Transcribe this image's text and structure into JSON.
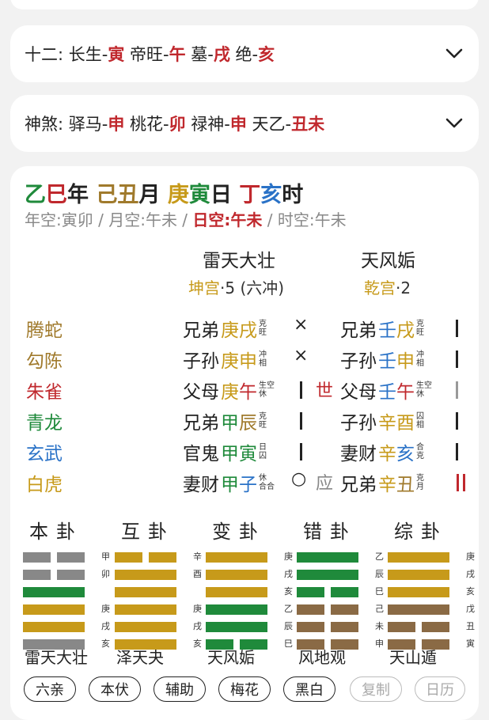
{
  "row_shier": {
    "prefix": "十二: ",
    "parts": [
      {
        "t": "长生-",
        "c": ""
      },
      {
        "t": "寅",
        "c": "red"
      },
      {
        "t": " 帝旺-",
        "c": ""
      },
      {
        "t": "午",
        "c": "red"
      },
      {
        "t": " 墓-",
        "c": ""
      },
      {
        "t": "戌",
        "c": "red"
      },
      {
        "t": " 绝-",
        "c": ""
      },
      {
        "t": "亥",
        "c": "red"
      }
    ]
  },
  "row_shensha": {
    "prefix": "神煞: ",
    "parts": [
      {
        "t": "驿马-",
        "c": ""
      },
      {
        "t": "申",
        "c": "red"
      },
      {
        "t": " 桃花-",
        "c": ""
      },
      {
        "t": "卯",
        "c": "red"
      },
      {
        "t": " 禄神-",
        "c": ""
      },
      {
        "t": "申",
        "c": "red"
      },
      {
        "t": " 天乙-",
        "c": ""
      },
      {
        "t": "丑未",
        "c": "red"
      }
    ]
  },
  "date": [
    {
      "t": "乙",
      "c": "#1f8a3b"
    },
    {
      "t": "巳",
      "c": "#c0282d"
    },
    {
      "t": "年 ",
      "c": "#222"
    },
    {
      "t": "己",
      "c": "#a07a2c"
    },
    {
      "t": "丑",
      "c": "#a07a2c"
    },
    {
      "t": "月 ",
      "c": "#222"
    },
    {
      "t": "庚",
      "c": "#c79a1a"
    },
    {
      "t": "寅",
      "c": "#1f8a3b"
    },
    {
      "t": "日 ",
      "c": "#222"
    },
    {
      "t": "丁",
      "c": "#c0282d"
    },
    {
      "t": "亥",
      "c": "#2a72c7"
    },
    {
      "t": "时",
      "c": "#222"
    }
  ],
  "kong": {
    "year": "年空:寅卯",
    "sep1": " / ",
    "month": "月空:午未",
    "sep2": " / ",
    "day": "日空:午未",
    "sep3": " / ",
    "hour": "时空:午未"
  },
  "gua_main": {
    "name": "雷天大壮",
    "palace": "坤宫",
    "rest": "·5 (六冲)"
  },
  "gua_change": {
    "name": "天风姤",
    "palace": "乾宫",
    "rest": "·2"
  },
  "gods": [
    {
      "t": "腾蛇",
      "c": "#a07a2c"
    },
    {
      "t": "勾陈",
      "c": "#a07a2c"
    },
    {
      "t": "朱雀",
      "c": "#c0282d"
    },
    {
      "t": "青龙",
      "c": "#1f8a3b"
    },
    {
      "t": "玄武",
      "c": "#2a72c7"
    },
    {
      "t": "白虎",
      "c": "#c79a1a"
    }
  ],
  "lines_main": [
    {
      "rel": "兄弟",
      "g1": "庚",
      "c1": "#c79a1a",
      "g2": "戌",
      "c2": "#c79a1a",
      "s1": "克",
      "s2": "旺"
    },
    {
      "rel": "子孙",
      "g1": "庚",
      "c1": "#c79a1a",
      "g2": "申",
      "c2": "#c79a1a",
      "s1": "冲",
      "s2": "相"
    },
    {
      "rel": "父母",
      "g1": "庚",
      "c1": "#c79a1a",
      "g2": "午",
      "c2": "#c0282d",
      "s1": "生空",
      "s2": "休"
    },
    {
      "rel": "兄弟",
      "g1": "甲",
      "c1": "#1f8a3b",
      "g2": "辰",
      "c2": "#a07a2c",
      "s1": "克",
      "s2": "旺"
    },
    {
      "rel": "官鬼",
      "g1": "甲",
      "c1": "#1f8a3b",
      "g2": "寅",
      "c2": "#1f8a3b",
      "s1": "日",
      "s2": "囚"
    },
    {
      "rel": "妻财",
      "g1": "甲",
      "c1": "#1f8a3b",
      "g2": "子",
      "c2": "#2a72c7",
      "s1": "休",
      "s2": "合合"
    }
  ],
  "moving_marks": [
    "×",
    "×",
    "",
    "",
    "",
    "○"
  ],
  "shi_ying": [
    "",
    "",
    "世",
    "",
    "",
    "应"
  ],
  "lines_change": [
    {
      "rel": "兄弟",
      "g1": "壬",
      "c1": "#2a72c7",
      "g2": "戌",
      "c2": "#c79a1a",
      "s1": "克",
      "s2": "旺"
    },
    {
      "rel": "子孙",
      "g1": "壬",
      "c1": "#2a72c7",
      "g2": "申",
      "c2": "#c79a1a",
      "s1": "冲",
      "s2": "相"
    },
    {
      "rel": "父母",
      "g1": "壬",
      "c1": "#2a72c7",
      "g2": "午",
      "c2": "#c0282d",
      "s1": "生空",
      "s2": "休"
    },
    {
      "rel": "子孙",
      "g1": "辛",
      "c1": "#c79a1a",
      "g2": "酉",
      "c2": "#c79a1a",
      "s1": "囚",
      "s2": "相"
    },
    {
      "rel": "妻财",
      "g1": "辛",
      "c1": "#c79a1a",
      "g2": "亥",
      "c2": "#2a72c7",
      "s1": "合",
      "s2": "克"
    },
    {
      "rel": "兄弟",
      "g1": "辛",
      "c1": "#c79a1a",
      "g2": "丑",
      "c2": "#a07a2c",
      "s1": "克",
      "s2": "月"
    }
  ],
  "hex_heads": [
    "本卦",
    "互卦",
    "变卦",
    "错卦",
    "综卦"
  ],
  "hex_names": [
    "雷天大壮",
    "泽天夬",
    "天风姤",
    "风地观",
    "天山遁"
  ],
  "hexagrams": [
    {
      "lines": [
        [
          0,
          "#888"
        ],
        [
          0,
          "#888"
        ],
        [
          1,
          "#1f8a3b"
        ],
        [
          1,
          "#c79a1a"
        ],
        [
          1,
          "#c79a1a"
        ],
        [
          1,
          "#888"
        ]
      ],
      "labels": [
        "甲",
        "卯",
        "",
        "庚",
        "戌",
        "亥"
      ]
    },
    {
      "lines": [
        [
          0,
          "#c79a1a"
        ],
        [
          1,
          "#c79a1a"
        ],
        [
          1,
          "#c79a1a"
        ],
        [
          1,
          "#c79a1a"
        ],
        [
          1,
          "#c79a1a"
        ],
        [
          1,
          "#c79a1a"
        ]
      ],
      "labels": [
        "辛",
        "酉",
        "",
        "庚",
        "戌",
        "亥"
      ]
    },
    {
      "lines": [
        [
          1,
          "#c79a1a"
        ],
        [
          1,
          "#c79a1a"
        ],
        [
          1,
          "#c79a1a"
        ],
        [
          1,
          "#1f8a3b"
        ],
        [
          1,
          "#1f8a3b"
        ],
        [
          0,
          "#1f8a3b"
        ]
      ],
      "labels": [
        "庚",
        "戌",
        "亥",
        "乙",
        "辰",
        "巳"
      ]
    },
    {
      "lines": [
        [
          1,
          "#1f8a3b"
        ],
        [
          1,
          "#1f8a3b"
        ],
        [
          0,
          "#1f8a3b"
        ],
        [
          0,
          "#8a6a45"
        ],
        [
          0,
          "#8a6a45"
        ],
        [
          0,
          "#8a6a45"
        ]
      ],
      "labels": [
        "乙",
        "辰",
        "巳",
        "己",
        "未",
        "申"
      ]
    },
    {
      "lines": [
        [
          1,
          "#c79a1a"
        ],
        [
          1,
          "#c79a1a"
        ],
        [
          1,
          "#c79a1a"
        ],
        [
          1,
          "#8a6a45"
        ],
        [
          0,
          "#8a6a45"
        ],
        [
          0,
          "#8a6a45"
        ]
      ],
      "labels": [
        "庚",
        "戌",
        "亥",
        "戊",
        "丑",
        "寅"
      ]
    }
  ],
  "buttons": [
    "六亲",
    "本伏",
    "辅助",
    "梅花",
    "黑白",
    "复制",
    "日历"
  ]
}
